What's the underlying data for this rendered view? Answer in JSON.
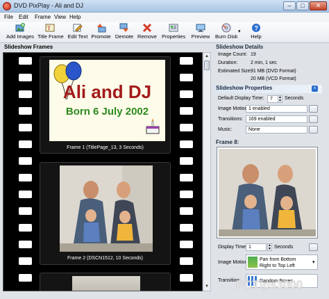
{
  "window": {
    "title": "DVD PixPlay - Ali and DJ"
  },
  "menu": [
    "File",
    "Edit",
    "Frame",
    "View",
    "Help"
  ],
  "toolbar": {
    "add_images": "Add Images",
    "title_frame": "Title Frame",
    "edit_text": "Edit Text",
    "promote": "Promote",
    "demote": "Demote",
    "remove": "Remove",
    "properties": "Properties",
    "preview": "Preview",
    "burn_disk": "Burn Disk",
    "help": "Help"
  },
  "slideshow_frames": {
    "header": "Slideshow Frames",
    "frames": [
      {
        "title_text": "Ali and DJ",
        "subtitle_text": "Born 6 July 2002",
        "caption": "Frame 1  (TitlePage_13, 3 Seconds)"
      },
      {
        "caption": "Frame 2  (DSCN1512, 10 Seconds)"
      }
    ]
  },
  "details": {
    "header": "Slideshow Details",
    "image_count_label": "Image Count:",
    "image_count": "19",
    "duration_label": "Duration:",
    "duration": "2 min, 1 sec",
    "size_label": "Estimated Size:",
    "size_dvd": "91 MB (DVD Format)",
    "size_vcd": "20 MB (VCD Format)"
  },
  "properties": {
    "header": "Slideshow Properties",
    "default_display_label": "Default Display Time:",
    "default_display_value": "7",
    "default_display_unit": "Seconds",
    "motion_label": "Image Motion:",
    "motion_value": "1 enabled",
    "transitions_label": "Transitions:",
    "transitions_value": "169 enabled",
    "music_label": "Music:",
    "music_value": "None"
  },
  "frame_panel": {
    "header": "Frame 8:",
    "display_time_label": "Display Time:",
    "display_time_value": "1",
    "display_time_unit": "Seconds",
    "motion_label": "Image Motion:",
    "motion_value_line1": "Pan from Bottom",
    "motion_value_line2": "Right to Top Left",
    "transition_label": "Transition:",
    "transition_value": "Random Boxes"
  },
  "watermark": "PCTips3000",
  "colors": {
    "title_text": "#a31a1a",
    "subtitle_text": "#2d8a1e",
    "film": "#000000",
    "section_header_bg": "#dbe6f3"
  }
}
